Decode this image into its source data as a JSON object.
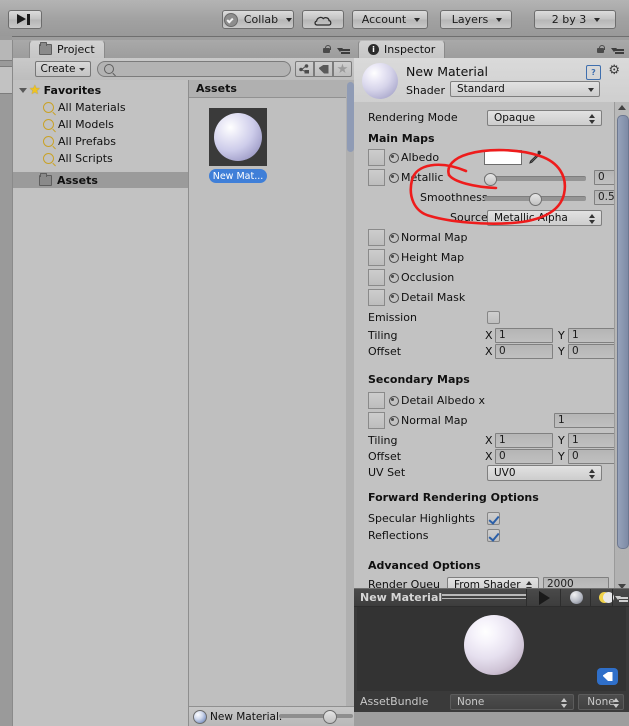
{
  "toolbar": {
    "step_button": "step-forward",
    "collab": "Collab",
    "cloud": "cloud-services",
    "account": "Account",
    "layers": "Layers",
    "layout": "2 by 3"
  },
  "project_panel": {
    "tab_label": "Project",
    "create_button": "Create",
    "search_placeholder": "",
    "search_value": "",
    "filter_icons": [
      "asset-type-filter-icon",
      "label-filter-icon",
      "favorite-filter-icon"
    ],
    "tree": [
      {
        "label": "Favorites",
        "icon": "star-icon",
        "bold": true,
        "indent": 20,
        "expanded": true
      },
      {
        "label": "All Materials",
        "icon": "search-icon",
        "bold": false,
        "indent": 34
      },
      {
        "label": "All Models",
        "icon": "search-icon",
        "bold": false,
        "indent": 34
      },
      {
        "label": "All Prefabs",
        "icon": "search-icon",
        "bold": false,
        "indent": 34
      },
      {
        "label": "All Scripts",
        "icon": "search-icon",
        "bold": false,
        "indent": 34
      },
      {
        "label": "Assets",
        "icon": "folder-icon",
        "bold": true,
        "indent": 30,
        "selected": true
      }
    ],
    "assets_header": "Assets",
    "asset_item_label": "New Mat...",
    "status_label": "New Material.",
    "zoom_slider_value": 60
  },
  "inspector": {
    "tab_label": "Inspector",
    "title": "New Material",
    "shader_label": "Shader",
    "shader_value": "Standard",
    "help_icon": "help-icon",
    "gear_icon": "gear-icon",
    "rendering_mode_label": "Rendering Mode",
    "rendering_mode_value": "Opaque",
    "main_maps_header": "Main Maps",
    "albedo_label": "Albedo",
    "albedo_color": "#ffffff",
    "eyedropper_icon": "eyedropper-icon",
    "metallic_label": "Metallic",
    "metallic_value": "0",
    "smoothness_label": "Smoothness",
    "smoothness_value": "0.5",
    "source_label": "Source",
    "source_value": "Metallic Alpha",
    "texture_slots": [
      "Normal Map",
      "Height Map",
      "Occlusion",
      "Detail Mask"
    ],
    "emission_label": "Emission",
    "emission_checked": false,
    "tiling_label": "Tiling",
    "tiling_x_label": "X",
    "tiling_x": "1",
    "tiling_y_label": "Y",
    "tiling_y": "1",
    "offset_label": "Offset",
    "offset_x_label": "X",
    "offset_x": "0",
    "offset_y_label": "Y",
    "offset_y": "0",
    "secondary_maps_header": "Secondary Maps",
    "detail_albedo_label": "Detail Albedo x",
    "secondary_normal_label": "Normal Map",
    "secondary_normal_value": "1",
    "sec_tiling_label": "Tiling",
    "sec_tiling_x_label": "X",
    "sec_tiling_x": "1",
    "sec_tiling_y_label": "Y",
    "sec_tiling_y": "1",
    "sec_offset_label": "Offset",
    "sec_offset_x_label": "X",
    "sec_offset_x": "0",
    "sec_offset_y_label": "Y",
    "sec_offset_y": "0",
    "uv_set_label": "UV Set",
    "uv_set_value": "UV0",
    "forward_header": "Forward Rendering Options",
    "specular_label": "Specular Highlights",
    "specular_checked": true,
    "reflections_label": "Reflections",
    "reflections_checked": true,
    "advanced_header": "Advanced Options",
    "render_queue_label": "Render Queu",
    "render_queue_value": "From Shader",
    "render_queue_number": "2000"
  },
  "annotation": {
    "color": "#ee1c1c",
    "shape": "hand-drawn-circle-around-albedo-color"
  },
  "preview": {
    "title": "New Material",
    "play_icon": "play-icon",
    "sphere_icon": "preview-mesh-icon",
    "light_icon": "preview-lighting-icon",
    "menu_icon": "preview-options-icon",
    "tag_icon": "label-tag-icon",
    "assetbundle_label": "AssetBundle",
    "assetbundle_value": "None",
    "assetbundle_variant": "None"
  }
}
